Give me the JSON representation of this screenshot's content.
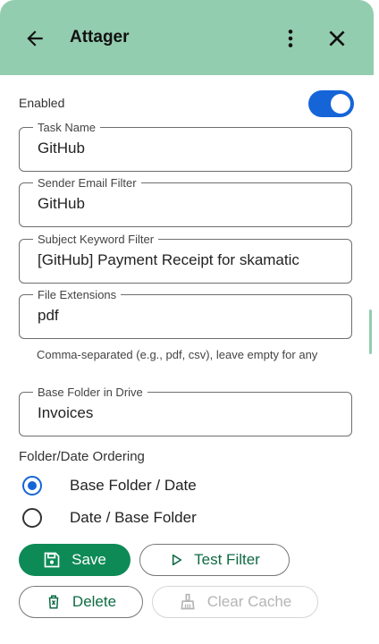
{
  "header": {
    "title": "Attager",
    "back_icon": "arrow-left-icon",
    "menu_icon": "more-vert-icon",
    "close_icon": "close-icon",
    "color": "#93cdaf"
  },
  "enabled": {
    "label": "Enabled",
    "value": true,
    "color": "#1565d8"
  },
  "fields": {
    "task_name": {
      "label": "Task Name",
      "value": "GitHub"
    },
    "sender_email": {
      "label": "Sender Email Filter",
      "value": "GitHub"
    },
    "subject_keyword": {
      "label": "Subject Keyword Filter",
      "value": "[GitHub] Payment Receipt for skamatic"
    },
    "file_extensions": {
      "label": "File Extensions",
      "value": "pdf",
      "helper": "Comma-separated (e.g., pdf, csv), leave empty for any"
    },
    "base_folder": {
      "label": "Base Folder in Drive",
      "value": "Invoices"
    }
  },
  "ordering": {
    "label": "Folder/Date Ordering",
    "options": [
      {
        "label": "Base Folder / Date",
        "selected": true
      },
      {
        "label": "Date / Base Folder",
        "selected": false
      }
    ]
  },
  "buttons": {
    "save": {
      "label": "Save",
      "icon": "save-icon",
      "color": "#0e8a56"
    },
    "test_filter": {
      "label": "Test Filter",
      "icon": "play-icon"
    },
    "delete": {
      "label": "Delete",
      "icon": "delete-icon"
    },
    "clear_cache": {
      "label": "Clear Cache",
      "icon": "broom-icon",
      "disabled": true
    }
  }
}
